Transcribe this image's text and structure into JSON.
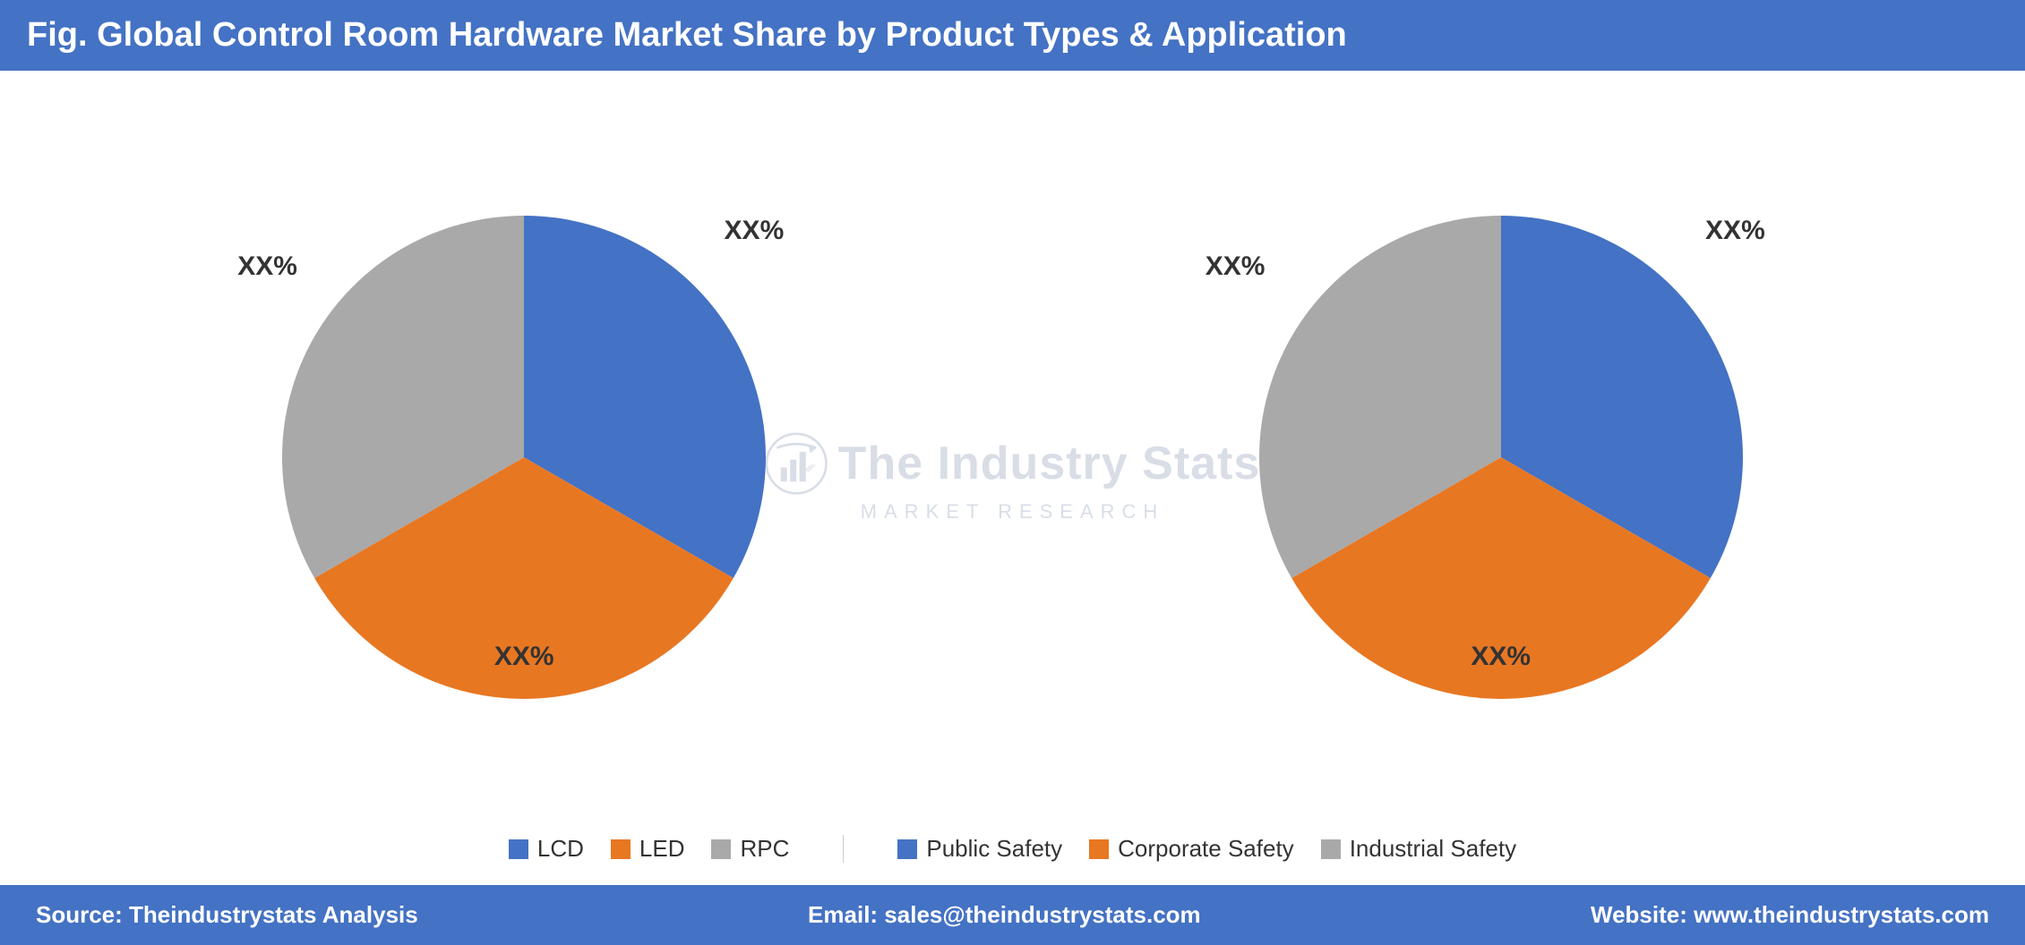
{
  "header": {
    "title": "Fig. Global Control Room Hardware Market Share by Product Types & Application"
  },
  "watermark": {
    "main": "The Industry Stats",
    "sub": "market research"
  },
  "left_chart": {
    "title": "Product Types",
    "segments": [
      {
        "label": "LCD",
        "color": "#4472C4",
        "startAngle": -90,
        "endAngle": 60,
        "percentage": "XX%"
      },
      {
        "label": "LED",
        "color": "#E87722",
        "startAngle": 60,
        "endAngle": 210,
        "percentage": "XX%"
      },
      {
        "label": "RPC",
        "color": "#A9A9A9",
        "startAngle": 210,
        "endAngle": 270,
        "percentage": "XX%"
      }
    ],
    "labels": {
      "top_right": "XX%",
      "bottom": "XX%",
      "top_left": "XX%"
    }
  },
  "right_chart": {
    "title": "Application",
    "segments": [
      {
        "label": "Public Safety",
        "color": "#4472C4",
        "startAngle": -90,
        "endAngle": 60,
        "percentage": "XX%"
      },
      {
        "label": "Corporate Safety",
        "color": "#E87722",
        "startAngle": 60,
        "endAngle": 210,
        "percentage": "XX%"
      },
      {
        "label": "Industrial Safety",
        "color": "#A9A9A9",
        "startAngle": 210,
        "endAngle": 270,
        "percentage": "XX%"
      }
    ],
    "labels": {
      "top_right": "XX%",
      "bottom": "XX%",
      "top_left": "XX%"
    }
  },
  "legend": {
    "left_items": [
      {
        "label": "LCD",
        "color": "#4472C4"
      },
      {
        "label": "LED",
        "color": "#E87722"
      },
      {
        "label": "RPC",
        "color": "#A9A9A9"
      }
    ],
    "right_items": [
      {
        "label": "Public Safety",
        "color": "#4472C4"
      },
      {
        "label": "Corporate Safety",
        "color": "#E87722"
      },
      {
        "label": "Industrial Safety",
        "color": "#A9A9A9"
      }
    ]
  },
  "footer": {
    "source": "Source: Theindustrystats Analysis",
    "email_label": "Email:",
    "email": "sales@theindustrystats.com",
    "website_label": "Website:",
    "website": "www.theindustrystats.com"
  }
}
